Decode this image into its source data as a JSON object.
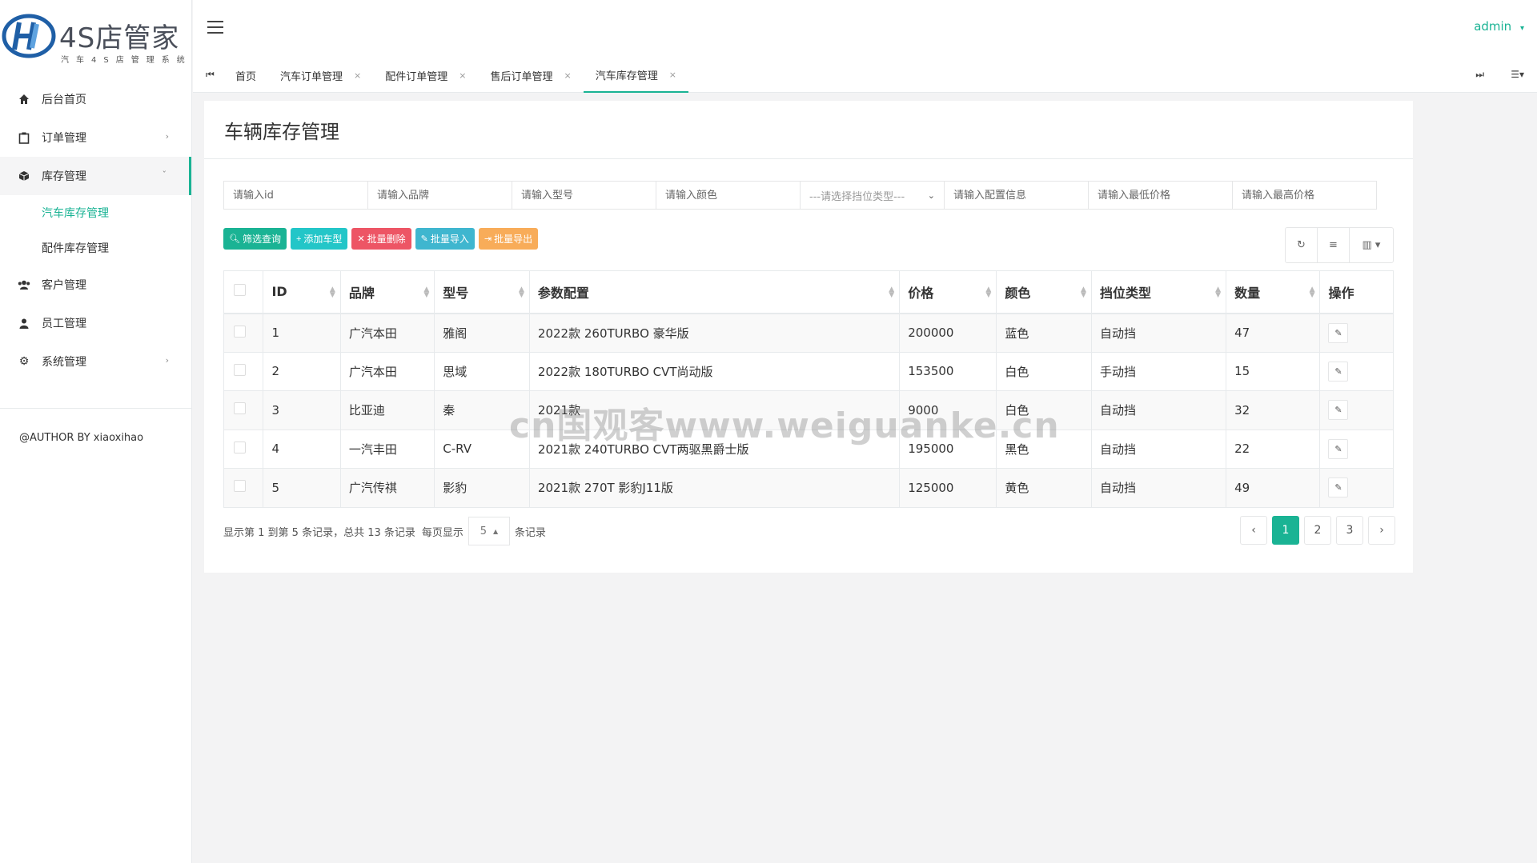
{
  "logo": {
    "title": "4S店管家",
    "subtitle": "汽车4S店管理系统"
  },
  "sidebar": {
    "items": [
      {
        "label": "后台首页",
        "icon": "home-icon"
      },
      {
        "label": "订单管理",
        "icon": "clipboard-icon"
      },
      {
        "label": "库存管理",
        "icon": "cube-icon"
      },
      {
        "label": "客户管理",
        "icon": "users-icon"
      },
      {
        "label": "员工管理",
        "icon": "user-icon"
      },
      {
        "label": "系统管理",
        "icon": "gear-icon"
      }
    ],
    "sub_items": [
      "汽车库存管理",
      "配件库存管理"
    ],
    "author": "@AUTHOR BY xiaoxihao"
  },
  "header": {
    "user": "admin"
  },
  "tabs": [
    {
      "label": "首页"
    },
    {
      "label": "汽车订单管理"
    },
    {
      "label": "配件订单管理"
    },
    {
      "label": "售后订单管理"
    },
    {
      "label": "汽车库存管理"
    }
  ],
  "page": {
    "title": "车辆库存管理"
  },
  "filters": {
    "id": "请输入id",
    "brand": "请输入品牌",
    "model": "请输入型号",
    "color": "请输入颜色",
    "gear": "---请选择挡位类型---",
    "config": "请输入配置信息",
    "min_price": "请输入最低价格",
    "max_price": "请输入最高价格"
  },
  "actions": {
    "search": "筛选查询",
    "add": "添加车型",
    "delete": "批量删除",
    "import": "批量导入",
    "export": "批量导出"
  },
  "table": {
    "columns": [
      "ID",
      "品牌",
      "型号",
      "参数配置",
      "价格",
      "颜色",
      "挡位类型",
      "数量",
      "操作"
    ],
    "rows": [
      [
        "1",
        "广汽本田",
        "雅阁",
        "2022款 260TURBO 豪华版",
        "200000",
        "蓝色",
        "自动挡",
        "47"
      ],
      [
        "2",
        "广汽本田",
        "思域",
        "2022款 180TURBO CVT尚动版",
        "153500",
        "白色",
        "手动挡",
        "15"
      ],
      [
        "3",
        "比亚迪",
        "秦",
        "2021款",
        "9000",
        "白色",
        "自动挡",
        "32"
      ],
      [
        "4",
        "一汽丰田",
        "C-RV",
        "2021款 240TURBO CVT两驱黑爵士版",
        "195000",
        "黑色",
        "自动挡",
        "22"
      ],
      [
        "5",
        "广汽传祺",
        "影豹",
        "2021款 270T 影豹J11版",
        "125000",
        "黄色",
        "自动挡",
        "49"
      ]
    ]
  },
  "pagination": {
    "summary": "显示第 1 到第 5 条记录，总共 13 条记录",
    "per_page_prefix": "每页显示",
    "per_page": "5",
    "per_page_suffix": "条记录",
    "pages": [
      "1",
      "2",
      "3"
    ],
    "current": "1"
  },
  "watermark": "cn国观客www.weiguanke.cn",
  "colors": {
    "accent": "#1ab394",
    "danger": "#ed5565",
    "warning": "#f8ac59",
    "info": "#23c6c8"
  }
}
